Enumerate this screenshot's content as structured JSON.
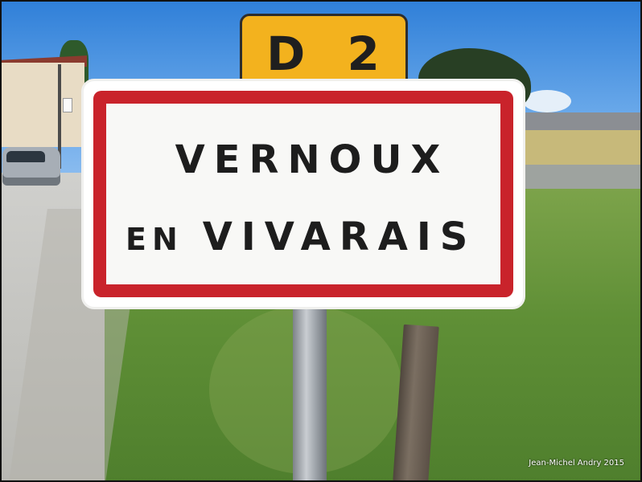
{
  "scene": {
    "description_elements": [
      "sky-icon",
      "house-icon",
      "tree-icon",
      "shed-icon",
      "road-icon",
      "car-icon",
      "grass-icon",
      "sign-post-icon",
      "fence-post-icon"
    ],
    "colors": {
      "sign_border": "#c9232b",
      "sign_background": "#f8f8f6",
      "route_plate": "#f3b21e",
      "text": "#1d1d1d"
    }
  },
  "route_plate": {
    "label": "D 2"
  },
  "town_sign": {
    "line1": "VERNOUX",
    "line2_prefix": "EN",
    "line2_name": "VIVARAIS"
  },
  "credit": {
    "text": "Jean-Michel Andry 2015"
  }
}
